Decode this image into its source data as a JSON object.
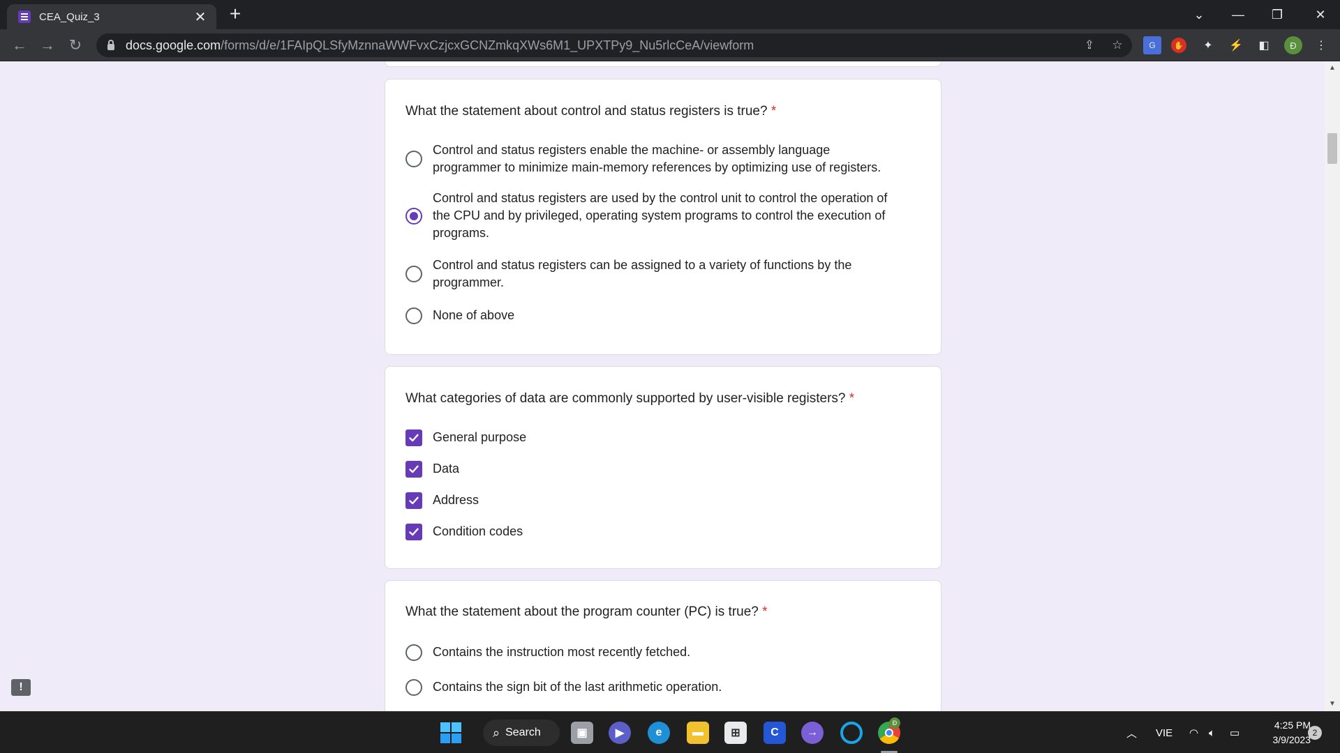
{
  "browser": {
    "tab_title": "CEA_Quiz_3",
    "new_tab_label": "+",
    "tab_close_label": "✕",
    "url_host": "docs.google.com",
    "url_path": "/forms/d/e/1FAIpQLSfyMznnaWWFvxCzjcxGCNZmkqXWs6M1_UPXTPy9_Nu5rlcCeA/viewform",
    "profile_initial": "Đ"
  },
  "questions": [
    {
      "title": "What the statement about control and status registers is true?",
      "required_mark": "*",
      "options": [
        {
          "lines": [
            "Control and status registers enable  the  machine-  or  assembly  language",
            "programmer to minimize main-memory references by optimizing use of registers."
          ],
          "selected": false
        },
        {
          "lines": [
            "Control and status registers are used by the control unit to control the operation of",
            "the CPU and by privileged, operating system programs to control the execution of",
            "programs."
          ],
          "selected": true
        },
        {
          "lines": [
            "Control and status registers can be assigned to a variety of functions by the",
            "programmer."
          ],
          "selected": false
        },
        {
          "lines": [
            "None of above"
          ],
          "selected": false
        }
      ]
    },
    {
      "title": "What categories of data are commonly supported by user-visible registers?",
      "required_mark": "*",
      "options": [
        {
          "label": "General purpose",
          "checked": true
        },
        {
          "label": "Data",
          "checked": true
        },
        {
          "label": "Address",
          "checked": true
        },
        {
          "label": "Condition codes",
          "checked": true
        }
      ]
    },
    {
      "title": "What the statement about the program counter (PC) is true?",
      "required_mark": "*",
      "options": [
        {
          "label": "Contains the instruction most recently fetched.",
          "selected": false
        },
        {
          "label": "Contains the sign bit of the last arithmetic operation.",
          "selected": false
        }
      ]
    }
  ],
  "feedback_label": "!",
  "taskbar": {
    "search_label": "Search",
    "language": "VIE",
    "time": "4:25 PM",
    "date": "3/9/2023",
    "notification_count": "2",
    "chrome_badge": "Đ"
  },
  "colors": {
    "accent": "#673ab7",
    "required": "#d93025",
    "page_bg": "#f0ebf8"
  }
}
